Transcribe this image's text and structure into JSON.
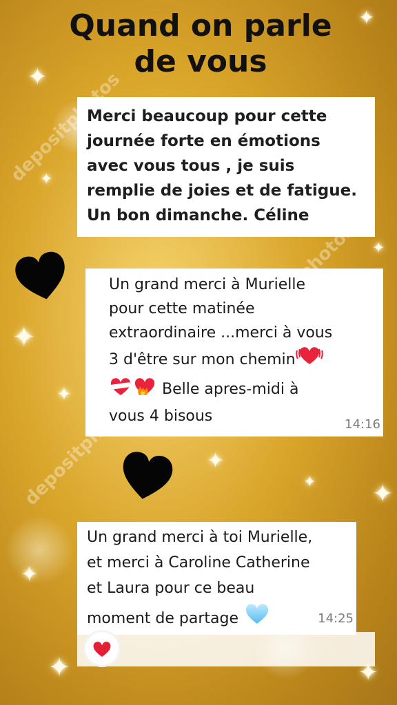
{
  "title": {
    "line1": "Quand on parle",
    "line2": "de vous"
  },
  "watermark": "depositphotos",
  "messages": [
    {
      "lines": [
        "Merci beaucoup pour cette",
        "journée forte en émotions",
        "avec vous tous , je suis",
        "remplie de joies et de fatigue.",
        "Un bon dimanche. Céline"
      ]
    },
    {
      "lines": [
        "Un grand merci à Murielle",
        "pour cette matinée",
        "extraordinaire ...merci à vous",
        "3 d'être sur mon chemin"
      ],
      "line5_text": "Belle apres-midi à",
      "line6": "vous 4 bisous",
      "time": "14:16"
    },
    {
      "lines": [
        "Un grand merci à toi Murielle,",
        "et merci à Caroline Catherine",
        "et Laura pour ce beau"
      ],
      "line4_text": "moment de partage",
      "time": "14:25"
    }
  ],
  "icons": {
    "black_heart_1": "black-heart-icon",
    "black_heart_2": "black-heart-icon",
    "vibrating_heart": "beating-heart-icon",
    "bandaged_heart": "mending-heart-icon",
    "fire_heart": "heart-on-fire-icon",
    "blue_heart": "light-blue-heart-icon",
    "reaction": "red-heart-icon"
  },
  "colors": {
    "background": "#d9a52a",
    "bubble": "#ffffff",
    "title": "#111111",
    "time": "#7a7a7a"
  }
}
